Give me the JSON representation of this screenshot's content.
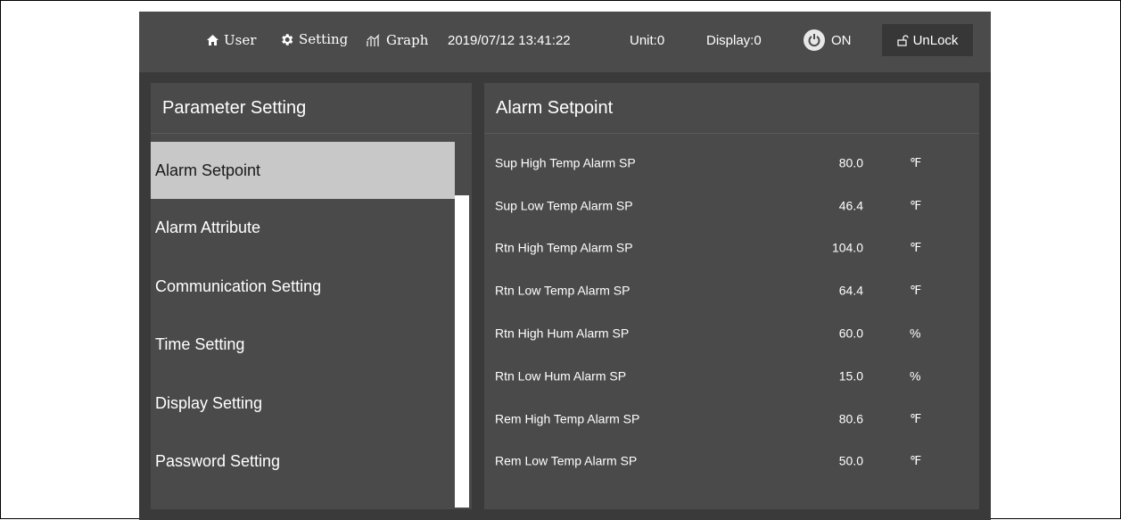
{
  "topbar": {
    "user_label": "User",
    "setting_label": "Setting",
    "graph_label": "Graph",
    "datetime": "2019/07/12 13:41:22",
    "unit": "Unit:0",
    "display": "Display:0",
    "power_label": "ON",
    "unlock_label": "UnLock"
  },
  "left_panel": {
    "title": "Parameter Setting",
    "items": [
      {
        "label": "Alarm Setpoint"
      },
      {
        "label": "Alarm Attribute"
      },
      {
        "label": "Communication Setting"
      },
      {
        "label": "Time Setting"
      },
      {
        "label": "Display Setting"
      },
      {
        "label": "Password Setting"
      }
    ]
  },
  "right_panel": {
    "title": "Alarm Setpoint",
    "rows": [
      {
        "name": "Sup High Temp Alarm SP",
        "value": "80.0",
        "unit": "℉"
      },
      {
        "name": "Sup Low Temp Alarm SP",
        "value": "46.4",
        "unit": "℉"
      },
      {
        "name": "Rtn High Temp Alarm SP",
        "value": "104.0",
        "unit": "℉"
      },
      {
        "name": "Rtn Low Temp Alarm SP",
        "value": "64.4",
        "unit": "℉"
      },
      {
        "name": "Rtn High Hum Alarm SP",
        "value": "60.0",
        "unit": "%"
      },
      {
        "name": "Rtn Low Hum Alarm SP",
        "value": "15.0",
        "unit": "%"
      },
      {
        "name": "Rem High Temp Alarm SP",
        "value": "80.6",
        "unit": "℉"
      },
      {
        "name": "Rem Low Temp Alarm SP",
        "value": "50.0",
        "unit": "℉"
      }
    ]
  },
  "icons": {
    "menu": "hamburger-icon",
    "user": "home-icon",
    "setting": "gear-icon",
    "graph": "graph-icon",
    "power": "power-icon",
    "lock": "unlock-icon"
  },
  "colors": {
    "screen_bg": "#3a3a3a",
    "topbar_bg": "#4b4b4b",
    "panel_bg": "#4a4a4a",
    "active_item_bg": "#c8c8c8"
  }
}
